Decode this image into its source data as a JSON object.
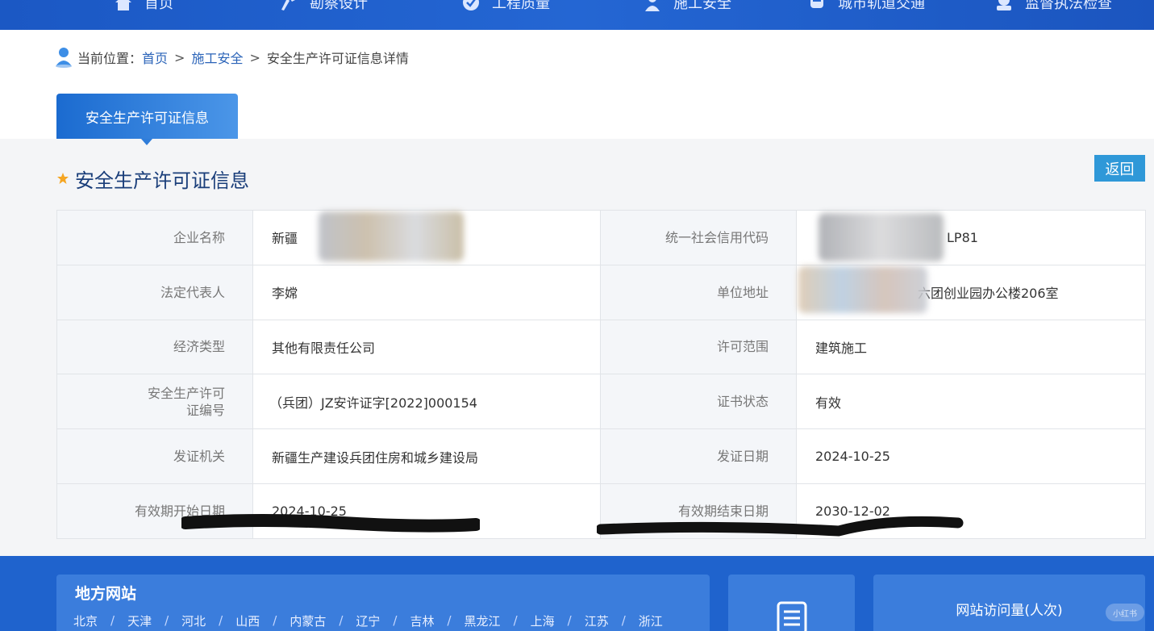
{
  "nav": {
    "items": [
      {
        "label": "首页",
        "icon": "home-icon"
      },
      {
        "label": "勘察设计",
        "icon": "design-icon"
      },
      {
        "label": "工程质量",
        "icon": "quality-icon"
      },
      {
        "label": "施工安全",
        "icon": "worker-icon"
      },
      {
        "label": "城市轨道交通",
        "icon": "train-icon"
      },
      {
        "label": "监督执法检查",
        "icon": "inspect-icon"
      }
    ]
  },
  "breadcrumb": {
    "prefix": "当前位置：",
    "home": "首页",
    "section": "施工安全",
    "current": "安全生产许可证信息详情",
    "separator": ">"
  },
  "tab": {
    "label": "安全生产许可证信息"
  },
  "section": {
    "title": "安全生产许可证信息",
    "back_label": "返回"
  },
  "table": {
    "rows": [
      [
        {
          "label": "企业名称",
          "value": "新疆"
        },
        {
          "label": "统一社会信用代码",
          "value": "LP81"
        }
      ],
      [
        {
          "label": "法定代表人",
          "value": "李嫦"
        },
        {
          "label": "单位地址",
          "value": "六团创业园办公楼206室"
        }
      ],
      [
        {
          "label": "经济类型",
          "value": "其他有限责任公司"
        },
        {
          "label": "许可范围",
          "value": "建筑施工"
        }
      ],
      [
        {
          "label": "安全生产许可证编号",
          "value": "（兵团）JZ安许证字[2022]000154"
        },
        {
          "label": "证书状态",
          "value": "有效"
        }
      ],
      [
        {
          "label": "发证机关",
          "value": "新疆生产建设兵团住房和城乡建设局"
        },
        {
          "label": "发证日期",
          "value": "2024-10-25"
        }
      ],
      [
        {
          "label": "有效期开始日期",
          "value": "2024-10-25"
        },
        {
          "label": "有效期结束日期",
          "value": "2030-12-02"
        }
      ]
    ],
    "cert_label_line1": "安全生产许可",
    "cert_label_line2": "证编号"
  },
  "footer": {
    "local_title": "地方网站",
    "cities": [
      "北京",
      "天津",
      "河北",
      "山西",
      "内蒙古",
      "辽宁",
      "吉林",
      "黑龙江",
      "上海",
      "江苏",
      "浙江"
    ],
    "city_separator": "/",
    "visits_title": "网站访问量(人次)",
    "watermark": "小红书"
  },
  "colors": {
    "nav_bg": "#1b58c4",
    "link": "#2a63b8",
    "title": "#1a3e7a",
    "back_button": "#2f98d8",
    "star": "#f5a623",
    "footer_bg": "#1f63cd"
  }
}
